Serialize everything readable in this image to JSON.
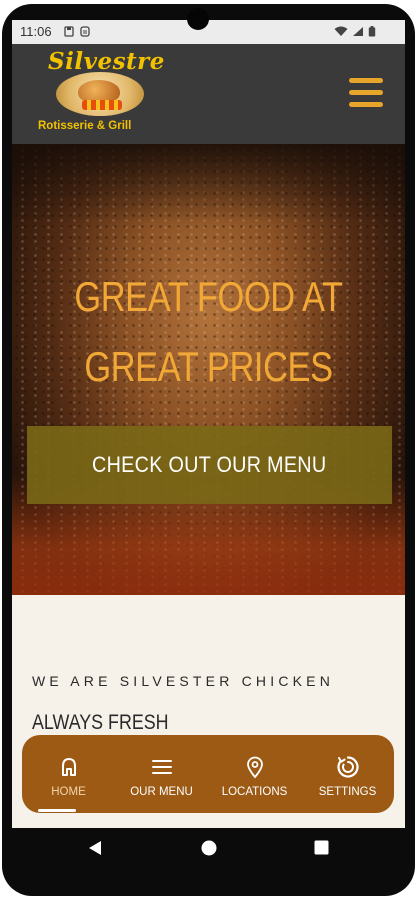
{
  "status_bar": {
    "time": "11:06"
  },
  "header": {
    "logo": {
      "brand": "Silvestre",
      "subtitle": "Rotisserie & Grill"
    },
    "menu_icon": "hamburger-icon"
  },
  "hero": {
    "title_line1": "GREAT FOOD AT",
    "title_line2": "GREAT PRICES",
    "cta_label": "CHECK OUT OUR MENU"
  },
  "content": {
    "tagline": "WE ARE SILVESTER CHICKEN",
    "subhead": "ALWAYS FRESH"
  },
  "tabs": [
    {
      "label": "HOME",
      "icon": "home-icon",
      "active": true
    },
    {
      "label": "OUR MENU",
      "icon": "menu-list-icon",
      "active": false
    },
    {
      "label": "LOCATIONS",
      "icon": "location-pin-icon",
      "active": false
    },
    {
      "label": "SETTINGS",
      "icon": "settings-icon",
      "active": false
    }
  ],
  "colors": {
    "header_bg": "#3a3a3a",
    "accent_gold": "#f1a836",
    "cta_bg": "#7a6816",
    "tabbar_bg": "#9c5a15",
    "content_bg": "#f6f2ea"
  }
}
